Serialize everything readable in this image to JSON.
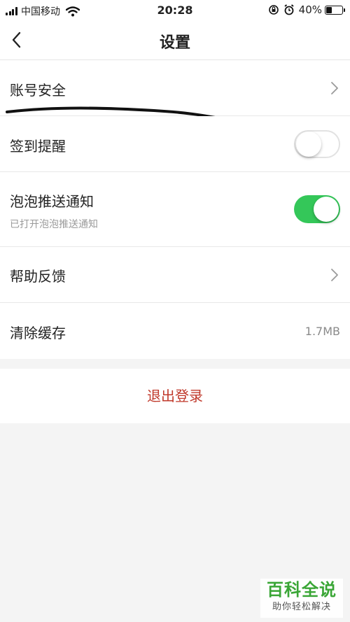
{
  "status_bar": {
    "carrier": "中国移动",
    "time": "20:28",
    "battery": "40%",
    "battery_level": 0.4
  },
  "nav": {
    "title": "设置",
    "back_icon": "chevron-left-icon"
  },
  "settings": {
    "account_security": {
      "label": "账号安全"
    },
    "signin_reminder": {
      "label": "签到提醒",
      "enabled": false
    },
    "bubble_push": {
      "label": "泡泡推送通知",
      "subtitle": "已打开泡泡推送通知",
      "enabled": true
    },
    "help_feedback": {
      "label": "帮助反馈"
    },
    "clear_cache": {
      "label": "清除缓存",
      "value": "1.7MB"
    }
  },
  "logout": {
    "label": "退出登录"
  },
  "watermark": {
    "title": "百科全说",
    "subtitle": "助你轻松解决"
  },
  "colors": {
    "toggle_on": "#34c759",
    "logout_text": "#c0392b",
    "watermark_green": "#3aa636"
  }
}
